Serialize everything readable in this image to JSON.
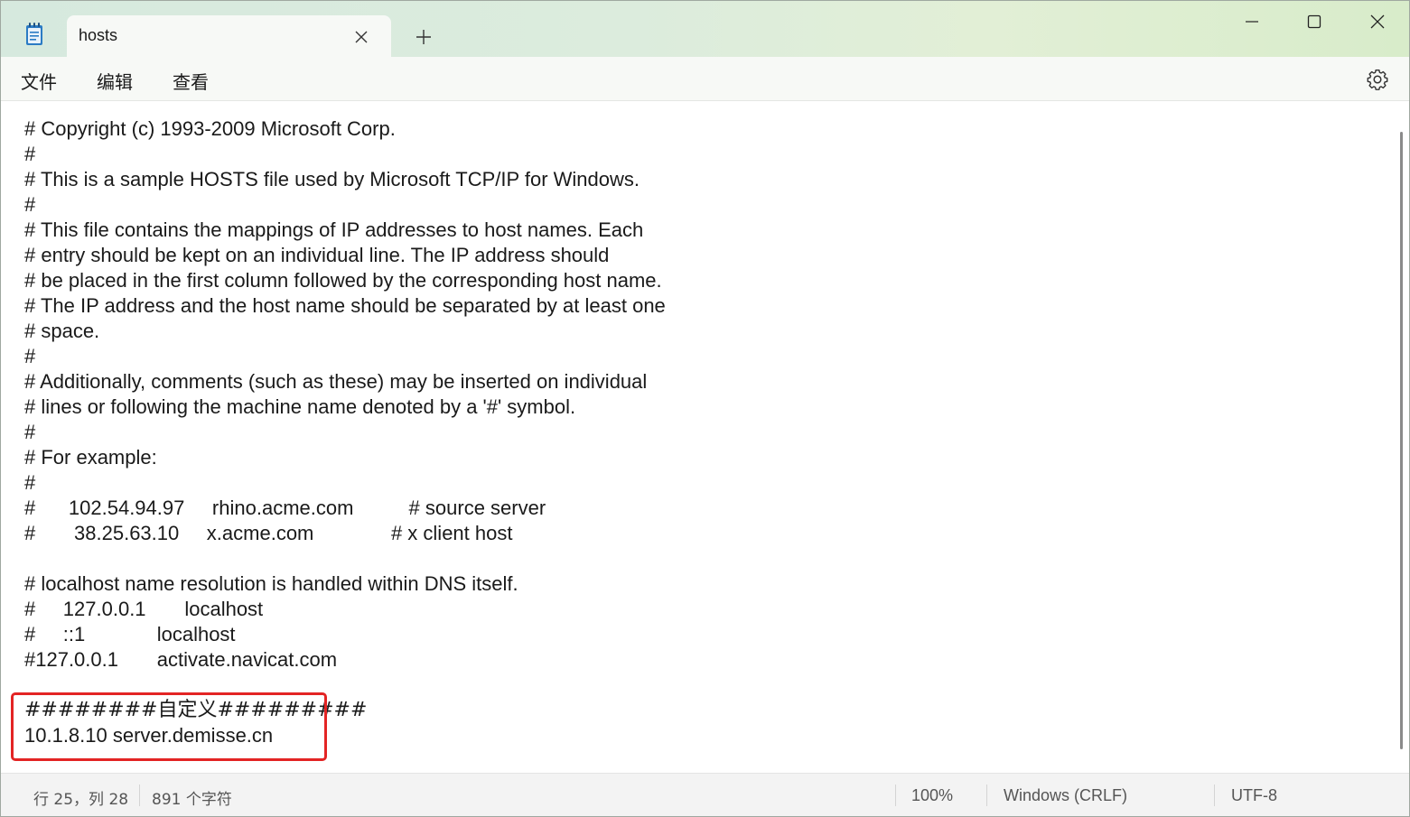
{
  "titlebar": {
    "tab_title": "hosts",
    "icons": {
      "app": "notepad-icon",
      "close_tab": "close-icon",
      "new_tab": "plus-icon"
    }
  },
  "window_controls": {
    "minimize": "minimize-icon",
    "maximize": "maximize-icon",
    "close": "close-icon"
  },
  "menu": {
    "file": "文件",
    "edit": "编辑",
    "view": "查看",
    "settings_icon": "gear-icon"
  },
  "editor": {
    "lines": [
      "# Copyright (c) 1993-2009 Microsoft Corp.",
      "#",
      "# This is a sample HOSTS file used by Microsoft TCP/IP for Windows.",
      "#",
      "# This file contains the mappings of IP addresses to host names. Each",
      "# entry should be kept on an individual line. The IP address should",
      "# be placed in the first column followed by the corresponding host name.",
      "# The IP address and the host name should be separated by at least one",
      "# space.",
      "#",
      "# Additionally, comments (such as these) may be inserted on individual",
      "# lines or following the machine name denoted by a '#' symbol.",
      "#",
      "# For example:",
      "#",
      "#      102.54.94.97     rhino.acme.com          # source server",
      "#       38.25.63.10     x.acme.com              # x client host",
      "",
      "# localhost name resolution is handled within DNS itself.",
      "#\t127.0.0.1       localhost",
      "#\t::1             localhost",
      "#127.0.0.1       activate.navicat.com",
      "",
      "########自定义#########",
      "10.1.8.10 server.demisse.cn"
    ],
    "highlight_color": "#e32424"
  },
  "statusbar": {
    "position": "行 25，列 28",
    "char_count": "891 个字符",
    "zoom": "100%",
    "line_ending": "Windows (CRLF)",
    "encoding": "UTF-8"
  }
}
